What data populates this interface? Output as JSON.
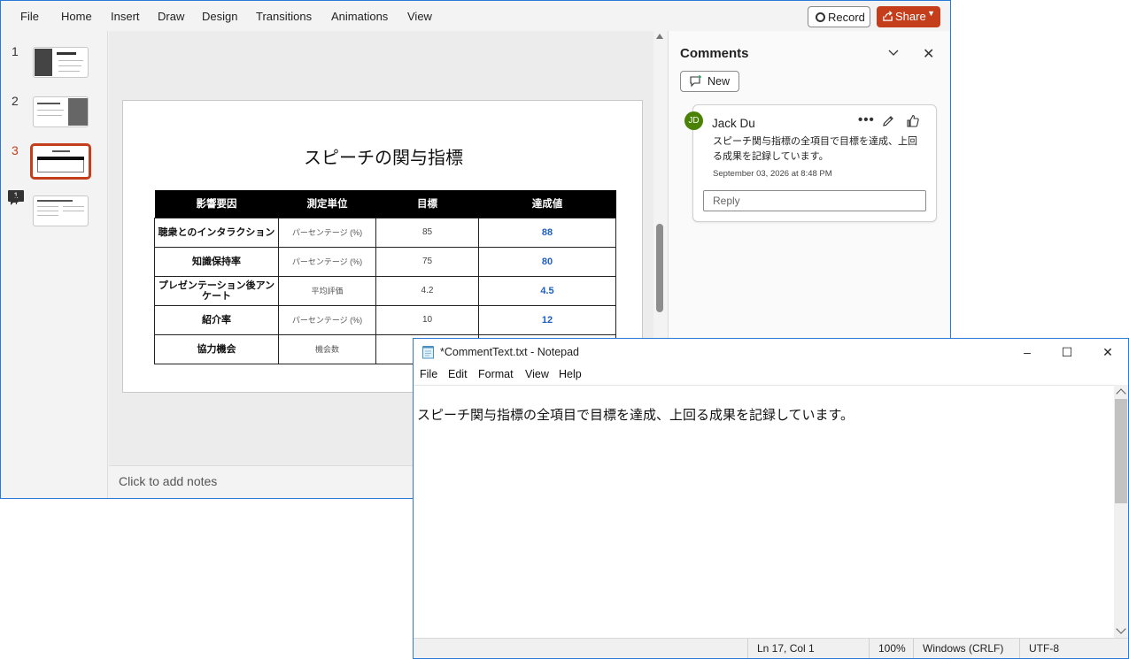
{
  "ppt": {
    "menu": [
      "File",
      "Home",
      "Insert",
      "Draw",
      "Design",
      "Transitions",
      "Animations",
      "View"
    ],
    "record_label": "Record",
    "share_label": "Share",
    "thumbnails": [
      {
        "number": "1"
      },
      {
        "number": "2"
      },
      {
        "number": "3",
        "comment_count": "1"
      },
      {
        "number": "4"
      }
    ],
    "slide": {
      "title": "スピーチの関与指標",
      "headers": [
        "影響要因",
        "測定単位",
        "目標",
        "達成値"
      ],
      "rows": [
        {
          "factor": "聴衆とのインタラクション",
          "unit": "パーセンテージ (%)",
          "target": "85",
          "actual": "88"
        },
        {
          "factor": "知識保持率",
          "unit": "パーセンテージ (%)",
          "target": "75",
          "actual": "80"
        },
        {
          "factor": "プレゼンテーション後アンケート",
          "unit": "平均評価",
          "target": "4.2",
          "actual": "4.5"
        },
        {
          "factor": "紹介率",
          "unit": "パーセンテージ (%)",
          "target": "10",
          "actual": "12"
        },
        {
          "factor": "協力機会",
          "unit": "機会数",
          "target": "",
          "actual": ""
        }
      ]
    },
    "notes_placeholder": "Click to add notes",
    "comments": {
      "title": "Comments",
      "new_label": "New",
      "card": {
        "initials": "JD",
        "author": "Jack Du",
        "text": "スピーチ関与指標の全項目で目標を達成、上回る成果を記録しています。",
        "date": "September 03, 2026 at 8:48 PM",
        "reply_placeholder": "Reply"
      }
    }
  },
  "notepad": {
    "title": "*CommentText.txt - Notepad",
    "menu": [
      "File",
      "Edit",
      "Format",
      "View",
      "Help"
    ],
    "content": "スピーチ関与指標の全項目で目標を達成、上回る成果を記録しています。",
    "status": {
      "position": "Ln 17, Col 1",
      "zoom": "100%",
      "line_ending": "Windows (CRLF)",
      "encoding": "UTF-8"
    }
  },
  "colors": {
    "accent": "#c43e1c",
    "value_blue": "#1f5fbf",
    "avatar_green": "#498205",
    "window_border": "#2b79d6"
  }
}
